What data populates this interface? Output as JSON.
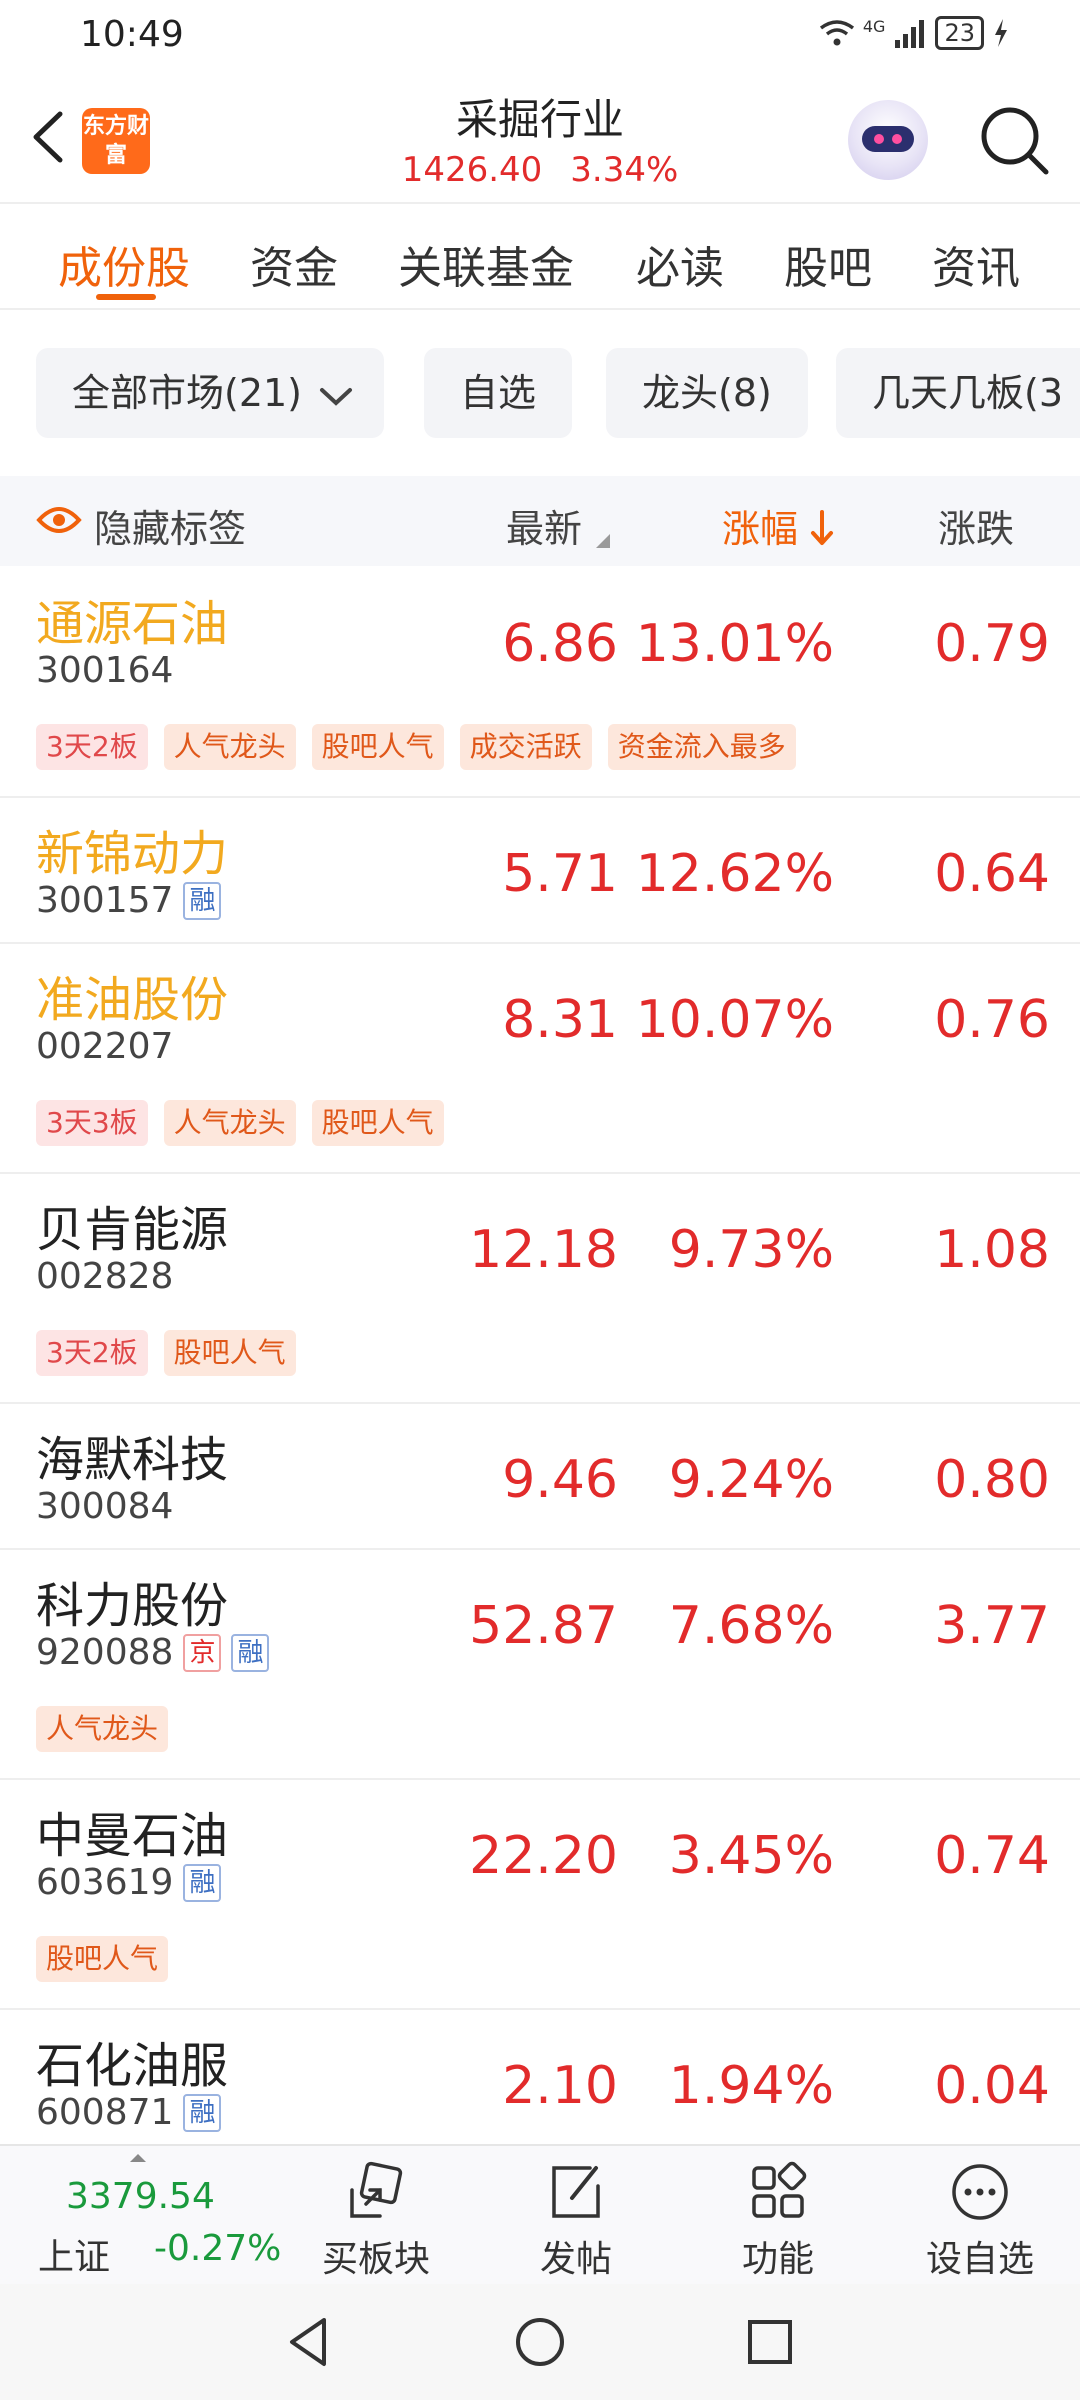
{
  "status_bar": {
    "time": "10:49",
    "network": "4G",
    "battery": "23"
  },
  "header": {
    "logo_text": "东方财富",
    "title": "采掘行业",
    "index_value": "1426.40",
    "index_change": "3.34%"
  },
  "tabs": [
    "成份股",
    "资金",
    "关联基金",
    "必读",
    "股吧",
    "资讯"
  ],
  "active_tab": 0,
  "filters": [
    {
      "label": "全部市场(21)"
    },
    {
      "label": "自选"
    },
    {
      "label": "龙头(8)"
    },
    {
      "label": "几天几板(3"
    }
  ],
  "columns": {
    "hide_tags": "隐藏标签",
    "latest": "最新",
    "change_pct": "涨幅",
    "change": "涨跌"
  },
  "stocks": [
    {
      "name": "通源石油",
      "code": "300164",
      "latest": "6.86",
      "change_pct": "13.01%",
      "change": "0.79",
      "badges": [],
      "tags": [
        {
          "text": "3天2板",
          "style": "pink"
        },
        {
          "text": "人气龙头",
          "style": "orange"
        },
        {
          "text": "股吧人气",
          "style": "orange"
        },
        {
          "text": "成交活跃",
          "style": "orange"
        },
        {
          "text": "资金流入最多",
          "style": "orange"
        }
      ]
    },
    {
      "name": "新锦动力",
      "code": "300157",
      "latest": "5.71",
      "change_pct": "12.62%",
      "change": "0.64",
      "badges": [
        "融"
      ],
      "tags": []
    },
    {
      "name": "准油股份",
      "code": "002207",
      "latest": "8.31",
      "change_pct": "10.07%",
      "change": "0.76",
      "badges": [],
      "tags": [
        {
          "text": "3天3板",
          "style": "pink"
        },
        {
          "text": "人气龙头",
          "style": "orange"
        },
        {
          "text": "股吧人气",
          "style": "orange"
        }
      ]
    },
    {
      "name": "贝肯能源",
      "code": "002828",
      "latest": "12.18",
      "change_pct": "9.73%",
      "change": "1.08",
      "badges": [],
      "tags": [
        {
          "text": "3天2板",
          "style": "pink"
        },
        {
          "text": "股吧人气",
          "style": "orange"
        }
      ]
    },
    {
      "name": "海默科技",
      "code": "300084",
      "latest": "9.46",
      "change_pct": "9.24%",
      "change": "0.80",
      "badges": [],
      "tags": []
    },
    {
      "name": "科力股份",
      "code": "920088",
      "latest": "52.87",
      "change_pct": "7.68%",
      "change": "3.77",
      "badges": [
        "京",
        "融"
      ],
      "tags": [
        {
          "text": "人气龙头",
          "style": "orange"
        }
      ]
    },
    {
      "name": "中曼石油",
      "code": "603619",
      "latest": "22.20",
      "change_pct": "3.45%",
      "change": "0.74",
      "badges": [
        "融"
      ],
      "tags": [
        {
          "text": "股吧人气",
          "style": "orange"
        }
      ]
    },
    {
      "name": "石化油服",
      "code": "600871",
      "latest": "2.10",
      "change_pct": "1.94%",
      "change": "0.04",
      "badges": [
        "融"
      ],
      "tags": []
    }
  ],
  "bottom_bar": {
    "index_value": "3379.54",
    "index_name": "上证",
    "index_change": "-0.27%",
    "buttons": [
      "买板块",
      "发帖",
      "功能",
      "设自选"
    ]
  },
  "colors": {
    "accent": "#f0620b",
    "up": "#e22b2b",
    "down": "#1a9a3c",
    "hot_name": "#f2a91f"
  }
}
